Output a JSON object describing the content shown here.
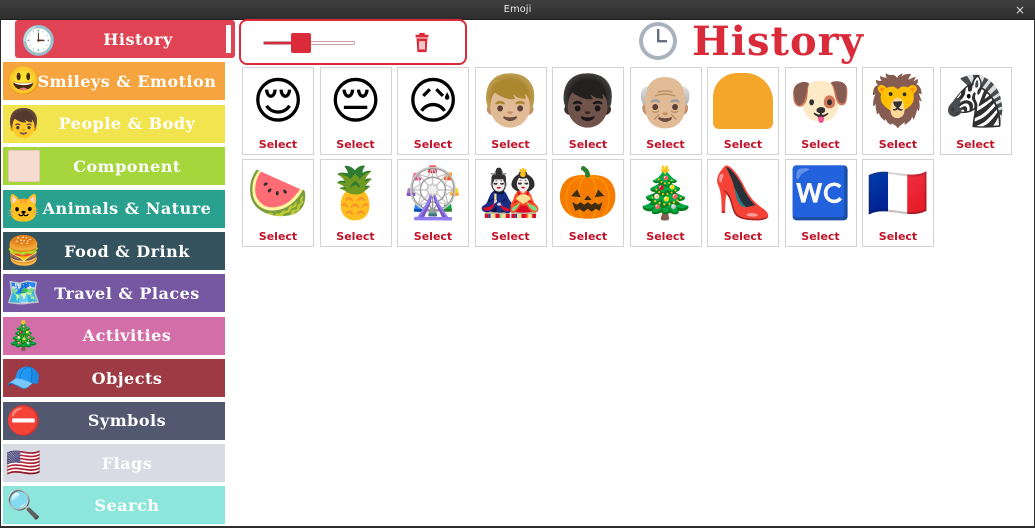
{
  "window": {
    "title": "Emoji",
    "close_label": "×"
  },
  "sidebar": {
    "items": [
      {
        "label": "History",
        "icon": "🕒",
        "icon_name": "clock-icon",
        "bg": "#e04454",
        "text": "#ffffff",
        "active": true
      },
      {
        "label": "Smileys & Emotion",
        "icon": "😃",
        "icon_name": "smiley-icon",
        "bg": "#f6a43f",
        "text": "#ffffff"
      },
      {
        "label": "People & Body",
        "icon": "👦",
        "icon_name": "person-icon",
        "bg": "#f2e44f",
        "text": "#ffffff"
      },
      {
        "label": "Component",
        "icon": "",
        "icon_name": "skin-tone-swatch-icon",
        "bg": "#a5d63b",
        "text": "#ffffff"
      },
      {
        "label": "Animals & Nature",
        "icon": "🐱",
        "icon_name": "cat-icon",
        "bg": "#2aa18f",
        "text": "#ffffff"
      },
      {
        "label": "Food & Drink",
        "icon": "🍔",
        "icon_name": "burger-icon",
        "bg": "#35525f",
        "text": "#ffffff"
      },
      {
        "label": "Travel & Places",
        "icon": "🗺️",
        "icon_name": "map-icon",
        "bg": "#7657a2",
        "text": "#ffffff"
      },
      {
        "label": "Activities",
        "icon": "🎄",
        "icon_name": "christmas-tree-icon",
        "bg": "#d36ea8",
        "text": "#ffffff"
      },
      {
        "label": "Objects",
        "icon": "🧢",
        "icon_name": "cap-icon",
        "bg": "#9d3a43",
        "text": "#ffffff"
      },
      {
        "label": "Symbols",
        "icon": "⛔",
        "icon_name": "no-entry-icon",
        "bg": "#525870",
        "text": "#ffffff"
      },
      {
        "label": "Flags",
        "icon": "🇺🇸",
        "icon_name": "us-flag-icon",
        "bg": "#d8dbe3",
        "text": "#ffffff"
      },
      {
        "label": "Search",
        "icon": "🔍",
        "icon_name": "magnifier-icon",
        "bg": "#8de6dc",
        "text": "#ffffff"
      }
    ]
  },
  "controls": {
    "slider_value_fraction": 0.5,
    "accent": "#d92b3a",
    "trash_icon": "trash-icon"
  },
  "header": {
    "title": "History",
    "icon": "clock-icon"
  },
  "grid": {
    "select_label": "Select",
    "emojis": [
      {
        "char": "😌",
        "name": "relieved-face"
      },
      {
        "char": "😔",
        "name": "pensive-face"
      },
      {
        "char": "😥",
        "name": "sad-relieved-face"
      },
      {
        "char": "👦🏼",
        "name": "boy-light-skin"
      },
      {
        "char": "👦🏿",
        "name": "boy-dark-skin"
      },
      {
        "char": "👴🏼",
        "name": "old-man-light-skin"
      },
      {
        "char": "",
        "name": "blonde-hair-component",
        "swatch": "#f4a62a"
      },
      {
        "char": "🐶",
        "name": "dog-face"
      },
      {
        "char": "🦁",
        "name": "lion-face"
      },
      {
        "char": "🦓",
        "name": "zebra"
      },
      {
        "char": "🍉",
        "name": "watermelon"
      },
      {
        "char": "🍍",
        "name": "pineapple"
      },
      {
        "char": "🎡",
        "name": "ferris-wheel"
      },
      {
        "char": "🎎",
        "name": "japanese-dolls"
      },
      {
        "char": "🎃",
        "name": "jack-o-lantern"
      },
      {
        "char": "🎄",
        "name": "christmas-tree"
      },
      {
        "char": "👠",
        "name": "high-heeled-shoe"
      },
      {
        "char": "🚾",
        "name": "water-closet"
      },
      {
        "char": "🇫🇷",
        "name": "flag-france"
      }
    ]
  }
}
